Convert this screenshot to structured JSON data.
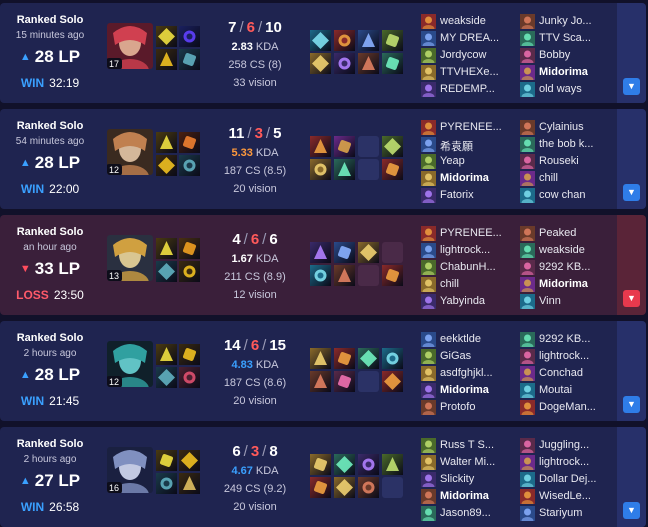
{
  "colors": {
    "win_bg": "#1f2450",
    "loss_bg": "#3a1f3a",
    "win_accent": "#3aa0ff",
    "loss_accent": "#ff5a6a",
    "deaths": "#ff5a5a"
  },
  "matches": [
    {
      "queue": "Ranked Solo",
      "ago": "15 minutes ago",
      "lp_direction": "up",
      "lp": "28 LP",
      "result": "WIN",
      "duration": "32:19",
      "champ_level": "17",
      "kills": "7",
      "deaths": "6",
      "assists": "10",
      "kda_ratio": "2.83",
      "kda_label": "KDA",
      "kda_tone": "white",
      "cs": "258 CS (8)",
      "vision": "33 vision",
      "team1": [
        "weakside",
        "MY DREA...",
        "Jordycow",
        "TTVHEXe...",
        "REDEMP..."
      ],
      "team2": [
        "Junky Jo...",
        "TTV Sca...",
        "Bobby",
        "Midorima",
        "old ways"
      ],
      "self_team": 2,
      "self_index": 3
    },
    {
      "queue": "Ranked Solo",
      "ago": "54 minutes ago",
      "lp_direction": "up",
      "lp": "28 LP",
      "result": "WIN",
      "duration": "22:00",
      "champ_level": "12",
      "kills": "11",
      "deaths": "3",
      "assists": "5",
      "kda_ratio": "5.33",
      "kda_label": "KDA",
      "kda_tone": "orange",
      "cs": "187 CS (8.5)",
      "vision": "20 vision",
      "team1": [
        "PYRENEE...",
        "希袁願",
        "Yeap",
        "Midorima",
        "Fatorix"
      ],
      "team2": [
        "Cylainius",
        "the bob k...",
        "Rouseki",
        "chill",
        "cow chan"
      ],
      "self_team": 1,
      "self_index": 3
    },
    {
      "queue": "Ranked Solo",
      "ago": "an hour ago",
      "lp_direction": "down",
      "lp": "33 LP",
      "result": "LOSS",
      "duration": "23:50",
      "champ_level": "13",
      "kills": "4",
      "deaths": "6",
      "assists": "6",
      "kda_ratio": "1.67",
      "kda_label": "KDA",
      "kda_tone": "white",
      "cs": "211 CS (8.9)",
      "vision": "12 vision",
      "team1": [
        "PYRENEE...",
        "lightrock...",
        "ChabunH...",
        "chill",
        "Yabyinda"
      ],
      "team2": [
        "Peaked",
        "weakside",
        "9292 KB...",
        "Midorima",
        "Vinn"
      ],
      "self_team": 2,
      "self_index": 3
    },
    {
      "queue": "Ranked Solo",
      "ago": "2 hours ago",
      "lp_direction": "up",
      "lp": "28 LP",
      "result": "WIN",
      "duration": "21:45",
      "champ_level": "12",
      "kills": "14",
      "deaths": "6",
      "assists": "15",
      "kda_ratio": "4.83",
      "kda_label": "KDA",
      "kda_tone": "blue",
      "cs": "187 CS (8.6)",
      "vision": "20 vision",
      "team1": [
        "eekktlde",
        "GiGas",
        "asdfghjkl...",
        "Midorima",
        "Protofo"
      ],
      "team2": [
        "9292 KB...",
        "lightrock...",
        "Conchad",
        "Moutai",
        "DogeMan..."
      ],
      "self_team": 1,
      "self_index": 3
    },
    {
      "queue": "Ranked Solo",
      "ago": "2 hours ago",
      "lp_direction": "up",
      "lp": "27 LP",
      "result": "WIN",
      "duration": "26:58",
      "champ_level": "16",
      "kills": "6",
      "deaths": "3",
      "assists": "8",
      "kda_ratio": "4.67",
      "kda_label": "KDA",
      "kda_tone": "blue",
      "cs": "249 CS (9.2)",
      "vision": "20 vision",
      "team1": [
        "Russ T S...",
        "Walter Mi...",
        "Slickity",
        "Midorima",
        "Jason89..."
      ],
      "team2": [
        "Juggling...",
        "lightrock...",
        "Dollar Dej...",
        "WisedLe...",
        "Stariyum"
      ],
      "self_team": 1,
      "self_index": 3
    }
  ]
}
